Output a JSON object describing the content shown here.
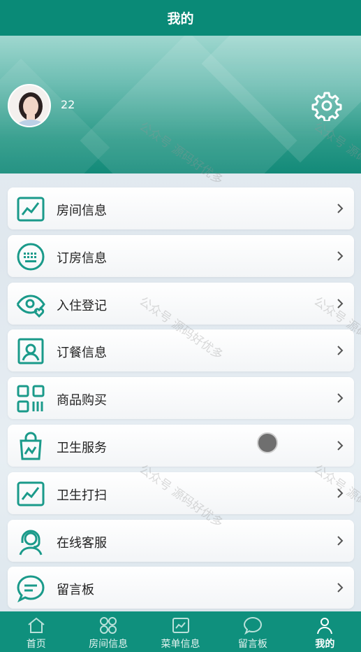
{
  "header": {
    "title": "我的"
  },
  "profile": {
    "username": "22"
  },
  "menu": [
    {
      "label": "房间信息",
      "icon": "chart-icon"
    },
    {
      "label": "订房信息",
      "icon": "keyboard-icon"
    },
    {
      "label": "入住登记",
      "icon": "eye-heart-icon"
    },
    {
      "label": "订餐信息",
      "icon": "id-card-icon"
    },
    {
      "label": "商品购买",
      "icon": "qr-code-icon"
    },
    {
      "label": "卫生服务",
      "icon": "shopping-bag-icon"
    },
    {
      "label": "卫生打扫",
      "icon": "chart-icon"
    },
    {
      "label": "在线客服",
      "icon": "headset-icon"
    },
    {
      "label": "留言板",
      "icon": "chat-icon"
    }
  ],
  "tabbar": [
    {
      "label": "首页",
      "icon": "home-icon"
    },
    {
      "label": "房间信息",
      "icon": "grid-icon"
    },
    {
      "label": "菜单信息",
      "icon": "menu-board-icon"
    },
    {
      "label": "留言板",
      "icon": "chat-icon"
    },
    {
      "label": "我的",
      "icon": "user-icon",
      "active": true
    }
  ],
  "watermark": "公众号 源码好优多",
  "colors": {
    "primary": "#0a8a77",
    "icon": "#1a9a8a"
  }
}
